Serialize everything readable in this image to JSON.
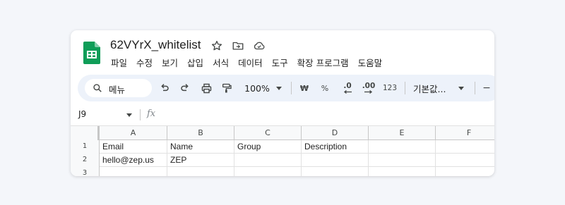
{
  "document": {
    "title": "62VYrX_whitelist"
  },
  "menubar": {
    "items": [
      "파일",
      "수정",
      "보기",
      "삽입",
      "서식",
      "데이터",
      "도구",
      "확장 프로그램",
      "도움말"
    ]
  },
  "toolbar": {
    "search_label": "메뉴",
    "zoom": "100%",
    "currency": "₩",
    "percent": "%",
    "decrease_decimal": ".0",
    "increase_decimal": ".00",
    "number_format": "123",
    "font": "기본값...",
    "font_size_minus": "−"
  },
  "formula_bar": {
    "name_box": "J9",
    "fx": "fx"
  },
  "sheet": {
    "columns": [
      "A",
      "B",
      "C",
      "D",
      "E",
      "F"
    ],
    "rows": [
      {
        "number": "1",
        "cells": [
          "Email",
          "Name",
          "Group",
          "Description",
          "",
          ""
        ]
      },
      {
        "number": "2",
        "cells": [
          "hello@zep.us",
          "ZEP",
          "",
          "",
          "",
          ""
        ]
      },
      {
        "number": "3",
        "cells": [
          "",
          "",
          "",
          "",
          "",
          ""
        ]
      }
    ]
  },
  "colors": {
    "sheets_green": "#0f9d58",
    "toolbar_bg": "#edf2fa",
    "page_bg": "#f4f6fa"
  }
}
